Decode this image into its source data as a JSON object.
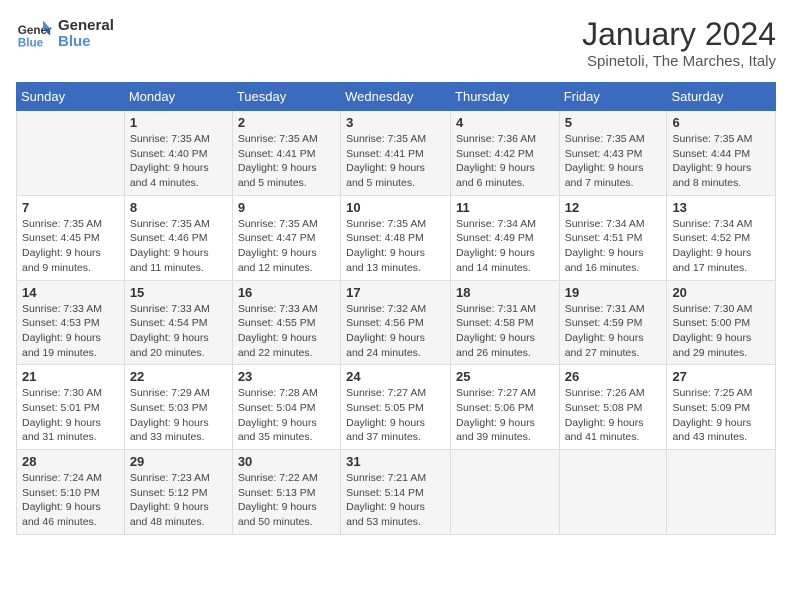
{
  "logo": {
    "text_general": "General",
    "text_blue": "Blue"
  },
  "header": {
    "month": "January 2024",
    "location": "Spinetoli, The Marches, Italy"
  },
  "days_of_week": [
    "Sunday",
    "Monday",
    "Tuesday",
    "Wednesday",
    "Thursday",
    "Friday",
    "Saturday"
  ],
  "weeks": [
    [
      {
        "day": "",
        "sunrise": "",
        "sunset": "",
        "daylight": ""
      },
      {
        "day": "1",
        "sunrise": "Sunrise: 7:35 AM",
        "sunset": "Sunset: 4:40 PM",
        "daylight": "Daylight: 9 hours and 4 minutes."
      },
      {
        "day": "2",
        "sunrise": "Sunrise: 7:35 AM",
        "sunset": "Sunset: 4:41 PM",
        "daylight": "Daylight: 9 hours and 5 minutes."
      },
      {
        "day": "3",
        "sunrise": "Sunrise: 7:35 AM",
        "sunset": "Sunset: 4:41 PM",
        "daylight": "Daylight: 9 hours and 5 minutes."
      },
      {
        "day": "4",
        "sunrise": "Sunrise: 7:36 AM",
        "sunset": "Sunset: 4:42 PM",
        "daylight": "Daylight: 9 hours and 6 minutes."
      },
      {
        "day": "5",
        "sunrise": "Sunrise: 7:35 AM",
        "sunset": "Sunset: 4:43 PM",
        "daylight": "Daylight: 9 hours and 7 minutes."
      },
      {
        "day": "6",
        "sunrise": "Sunrise: 7:35 AM",
        "sunset": "Sunset: 4:44 PM",
        "daylight": "Daylight: 9 hours and 8 minutes."
      }
    ],
    [
      {
        "day": "7",
        "sunrise": "Sunrise: 7:35 AM",
        "sunset": "Sunset: 4:45 PM",
        "daylight": "Daylight: 9 hours and 9 minutes."
      },
      {
        "day": "8",
        "sunrise": "Sunrise: 7:35 AM",
        "sunset": "Sunset: 4:46 PM",
        "daylight": "Daylight: 9 hours and 11 minutes."
      },
      {
        "day": "9",
        "sunrise": "Sunrise: 7:35 AM",
        "sunset": "Sunset: 4:47 PM",
        "daylight": "Daylight: 9 hours and 12 minutes."
      },
      {
        "day": "10",
        "sunrise": "Sunrise: 7:35 AM",
        "sunset": "Sunset: 4:48 PM",
        "daylight": "Daylight: 9 hours and 13 minutes."
      },
      {
        "day": "11",
        "sunrise": "Sunrise: 7:34 AM",
        "sunset": "Sunset: 4:49 PM",
        "daylight": "Daylight: 9 hours and 14 minutes."
      },
      {
        "day": "12",
        "sunrise": "Sunrise: 7:34 AM",
        "sunset": "Sunset: 4:51 PM",
        "daylight": "Daylight: 9 hours and 16 minutes."
      },
      {
        "day": "13",
        "sunrise": "Sunrise: 7:34 AM",
        "sunset": "Sunset: 4:52 PM",
        "daylight": "Daylight: 9 hours and 17 minutes."
      }
    ],
    [
      {
        "day": "14",
        "sunrise": "Sunrise: 7:33 AM",
        "sunset": "Sunset: 4:53 PM",
        "daylight": "Daylight: 9 hours and 19 minutes."
      },
      {
        "day": "15",
        "sunrise": "Sunrise: 7:33 AM",
        "sunset": "Sunset: 4:54 PM",
        "daylight": "Daylight: 9 hours and 20 minutes."
      },
      {
        "day": "16",
        "sunrise": "Sunrise: 7:33 AM",
        "sunset": "Sunset: 4:55 PM",
        "daylight": "Daylight: 9 hours and 22 minutes."
      },
      {
        "day": "17",
        "sunrise": "Sunrise: 7:32 AM",
        "sunset": "Sunset: 4:56 PM",
        "daylight": "Daylight: 9 hours and 24 minutes."
      },
      {
        "day": "18",
        "sunrise": "Sunrise: 7:31 AM",
        "sunset": "Sunset: 4:58 PM",
        "daylight": "Daylight: 9 hours and 26 minutes."
      },
      {
        "day": "19",
        "sunrise": "Sunrise: 7:31 AM",
        "sunset": "Sunset: 4:59 PM",
        "daylight": "Daylight: 9 hours and 27 minutes."
      },
      {
        "day": "20",
        "sunrise": "Sunrise: 7:30 AM",
        "sunset": "Sunset: 5:00 PM",
        "daylight": "Daylight: 9 hours and 29 minutes."
      }
    ],
    [
      {
        "day": "21",
        "sunrise": "Sunrise: 7:30 AM",
        "sunset": "Sunset: 5:01 PM",
        "daylight": "Daylight: 9 hours and 31 minutes."
      },
      {
        "day": "22",
        "sunrise": "Sunrise: 7:29 AM",
        "sunset": "Sunset: 5:03 PM",
        "daylight": "Daylight: 9 hours and 33 minutes."
      },
      {
        "day": "23",
        "sunrise": "Sunrise: 7:28 AM",
        "sunset": "Sunset: 5:04 PM",
        "daylight": "Daylight: 9 hours and 35 minutes."
      },
      {
        "day": "24",
        "sunrise": "Sunrise: 7:27 AM",
        "sunset": "Sunset: 5:05 PM",
        "daylight": "Daylight: 9 hours and 37 minutes."
      },
      {
        "day": "25",
        "sunrise": "Sunrise: 7:27 AM",
        "sunset": "Sunset: 5:06 PM",
        "daylight": "Daylight: 9 hours and 39 minutes."
      },
      {
        "day": "26",
        "sunrise": "Sunrise: 7:26 AM",
        "sunset": "Sunset: 5:08 PM",
        "daylight": "Daylight: 9 hours and 41 minutes."
      },
      {
        "day": "27",
        "sunrise": "Sunrise: 7:25 AM",
        "sunset": "Sunset: 5:09 PM",
        "daylight": "Daylight: 9 hours and 43 minutes."
      }
    ],
    [
      {
        "day": "28",
        "sunrise": "Sunrise: 7:24 AM",
        "sunset": "Sunset: 5:10 PM",
        "daylight": "Daylight: 9 hours and 46 minutes."
      },
      {
        "day": "29",
        "sunrise": "Sunrise: 7:23 AM",
        "sunset": "Sunset: 5:12 PM",
        "daylight": "Daylight: 9 hours and 48 minutes."
      },
      {
        "day": "30",
        "sunrise": "Sunrise: 7:22 AM",
        "sunset": "Sunset: 5:13 PM",
        "daylight": "Daylight: 9 hours and 50 minutes."
      },
      {
        "day": "31",
        "sunrise": "Sunrise: 7:21 AM",
        "sunset": "Sunset: 5:14 PM",
        "daylight": "Daylight: 9 hours and 53 minutes."
      },
      {
        "day": "",
        "sunrise": "",
        "sunset": "",
        "daylight": ""
      },
      {
        "day": "",
        "sunrise": "",
        "sunset": "",
        "daylight": ""
      },
      {
        "day": "",
        "sunrise": "",
        "sunset": "",
        "daylight": ""
      }
    ]
  ]
}
